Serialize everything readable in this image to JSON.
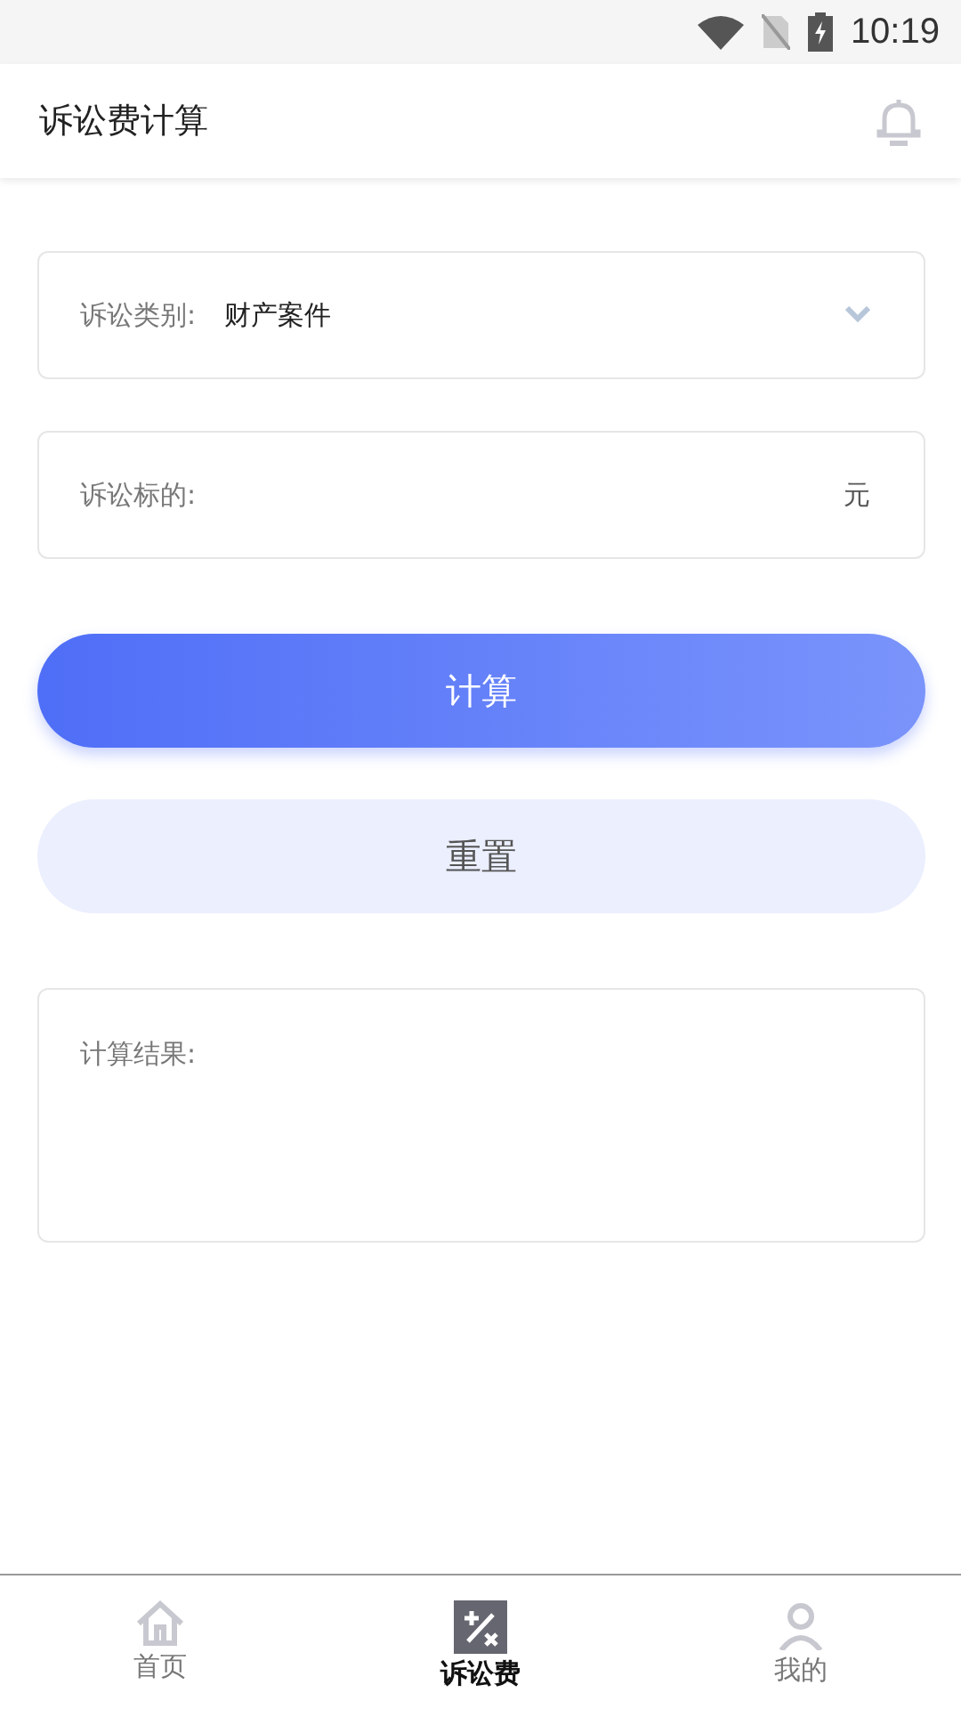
{
  "status_bar": {
    "time": "10:19"
  },
  "app_bar": {
    "title": "诉讼费计算"
  },
  "form": {
    "category": {
      "label": "诉讼类别:",
      "value": "财产案件"
    },
    "amount": {
      "label": "诉讼标的:",
      "unit": "元"
    }
  },
  "buttons": [
    {
      "kind": "primary",
      "label": "计算"
    },
    {
      "kind": "secondary",
      "label": "重置"
    }
  ],
  "result": {
    "label": "计算结果:"
  },
  "bottom_nav": [
    {
      "label": "首页",
      "kind": "home",
      "selected": false
    },
    {
      "label": "诉讼费",
      "kind": "calc",
      "selected": true
    },
    {
      "label": "我的",
      "kind": "person",
      "selected": false
    }
  ]
}
